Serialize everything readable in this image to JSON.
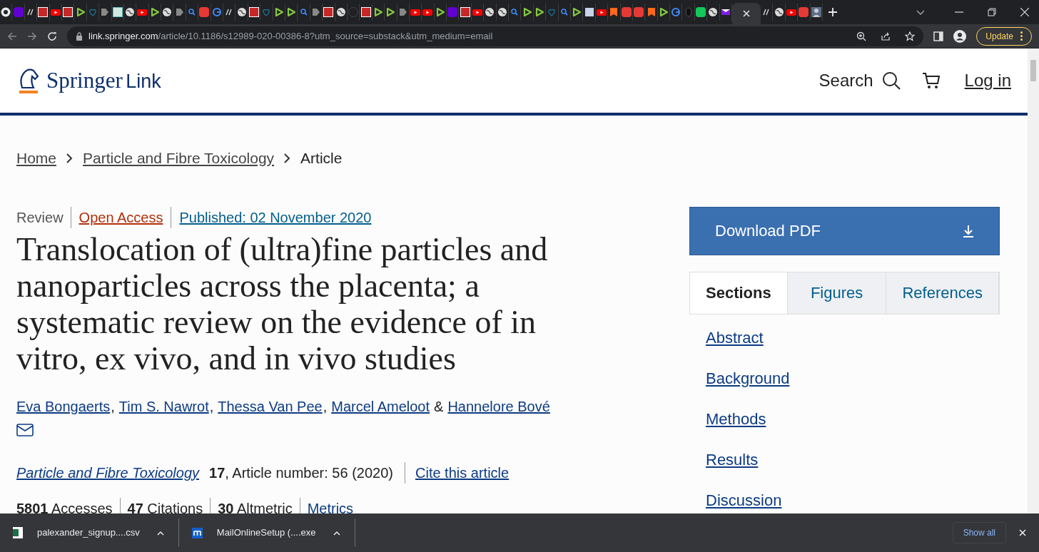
{
  "browser": {
    "tabs": [
      {
        "kind": "chrome",
        "selected": false
      },
      {
        "kind": "yahoo",
        "selected": false
      },
      {
        "kind": "uk",
        "selected": false
      },
      {
        "kind": "bi",
        "selected": false
      },
      {
        "kind": "youtube",
        "selected": false
      },
      {
        "kind": "bi",
        "selected": false
      },
      {
        "kind": "rumble",
        "selected": false
      },
      {
        "kind": "shield",
        "selected": false
      },
      {
        "kind": "arrow",
        "selected": false
      },
      {
        "kind": "doc",
        "selected": false
      },
      {
        "kind": "globe",
        "selected": false
      },
      {
        "kind": "youtube",
        "selected": false
      },
      {
        "kind": "rumble",
        "selected": false
      },
      {
        "kind": "globe",
        "selected": false
      },
      {
        "kind": "arrow",
        "selected": false
      },
      {
        "kind": "search",
        "selected": false
      },
      {
        "kind": "pin",
        "selected": false
      },
      {
        "kind": "google",
        "selected": false
      },
      {
        "kind": "uk",
        "selected": false
      },
      {
        "kind": "globe",
        "selected": false
      },
      {
        "kind": "bi",
        "selected": false
      },
      {
        "kind": "shield",
        "selected": false
      },
      {
        "kind": "rumble",
        "selected": false
      },
      {
        "kind": "rumble",
        "selected": false
      },
      {
        "kind": "search",
        "selected": false
      },
      {
        "kind": "arrow",
        "selected": false
      },
      {
        "kind": "bi",
        "selected": false
      },
      {
        "kind": "globe",
        "selected": false
      },
      {
        "kind": "blank",
        "selected": false
      },
      {
        "kind": "bi",
        "selected": false
      },
      {
        "kind": "rumble",
        "selected": false
      },
      {
        "kind": "rumble",
        "selected": false
      },
      {
        "kind": "arrow",
        "selected": false
      },
      {
        "kind": "youtube",
        "selected": false
      },
      {
        "kind": "youtube",
        "selected": false
      },
      {
        "kind": "rumble",
        "selected": false
      },
      {
        "kind": "yahoo",
        "selected": false
      },
      {
        "kind": "bi",
        "selected": false
      },
      {
        "kind": "youtube",
        "selected": false
      },
      {
        "kind": "globe",
        "selected": false
      },
      {
        "kind": "globe",
        "selected": false
      },
      {
        "kind": "search",
        "selected": false
      },
      {
        "kind": "rumble",
        "selected": false
      },
      {
        "kind": "rumble",
        "selected": false
      },
      {
        "kind": "shield",
        "selected": false
      },
      {
        "kind": "search",
        "selected": false
      },
      {
        "kind": "rumble",
        "selected": false
      },
      {
        "kind": "news",
        "selected": false
      },
      {
        "kind": "youtube",
        "selected": false
      },
      {
        "kind": "substack",
        "selected": false
      },
      {
        "kind": "pin",
        "selected": false
      },
      {
        "kind": "pin",
        "selected": false
      },
      {
        "kind": "substack",
        "selected": false
      },
      {
        "kind": "rumble",
        "selected": false
      },
      {
        "kind": "google",
        "selected": false
      },
      {
        "kind": "theta",
        "selected": false
      },
      {
        "kind": "gbook",
        "selected": false
      },
      {
        "kind": "globe",
        "selected": false
      },
      {
        "kind": "mail",
        "selected": false
      },
      {
        "selected": true
      },
      {
        "kind": "uk",
        "selected": false
      },
      {
        "kind": "globe",
        "selected": false
      },
      {
        "kind": "youtube",
        "selected": false
      },
      {
        "kind": "pin",
        "selected": false
      },
      {
        "kind": "person",
        "selected": false
      }
    ],
    "address": {
      "host": "link.springer.com",
      "path": "/article/10.1186/s12989-020-00386-8?utm_source=substack&utm_medium=email"
    },
    "update_button": "Update"
  },
  "page": {
    "logo": {
      "name": "Springer",
      "suffix": "Link"
    },
    "header_nav": {
      "search": "Search",
      "login": "Log in"
    },
    "breadcrumbs": [
      {
        "label": "Home",
        "kind": "link"
      },
      {
        "label": "Particle and Fibre Toxicology",
        "kind": "link"
      },
      {
        "label": "Article",
        "kind": "current"
      }
    ],
    "article": {
      "type": "Review",
      "access": "Open Access",
      "published": "Published: 02 November 2020",
      "title": "Translocation of (ultra)fine particles and nanoparticles across the placenta; a systematic review on the evidence of in vitro, ex vivo, and in vivo studies",
      "authors": [
        {
          "name": "Eva Bongaerts",
          "after": ","
        },
        {
          "name": "Tim S. Nawrot",
          "after": ","
        },
        {
          "name": "Thessa Van Pee",
          "after": ","
        },
        {
          "name": "Marcel Ameloot",
          "after": "&"
        },
        {
          "name": "Hannelore Bové"
        }
      ],
      "journal": "Particle and Fibre Toxicology",
      "volume": "17",
      "citation": ", Article number: 56 (2020)",
      "cite": "Cite this article",
      "metrics": [
        "**5801** Accesses",
        "**47** Citations",
        "**30** Altmetric"
      ],
      "metrics_link": "Metrics"
    },
    "sidebar": {
      "download": "Download PDF",
      "tabs": [
        {
          "label": "Sections",
          "selected": true
        },
        {
          "label": "Figures",
          "selected": false
        },
        {
          "label": "References",
          "selected": false
        }
      ],
      "sections": [
        "Abstract",
        "Background",
        "Methods",
        "Results",
        "Discussion"
      ]
    }
  },
  "downloads": {
    "items": [
      {
        "name": "palexander_signup....csv",
        "kind": "excel"
      },
      {
        "name": "MailOnlineSetup (....exe",
        "kind": "mail"
      }
    ],
    "show_all": "Show all"
  }
}
